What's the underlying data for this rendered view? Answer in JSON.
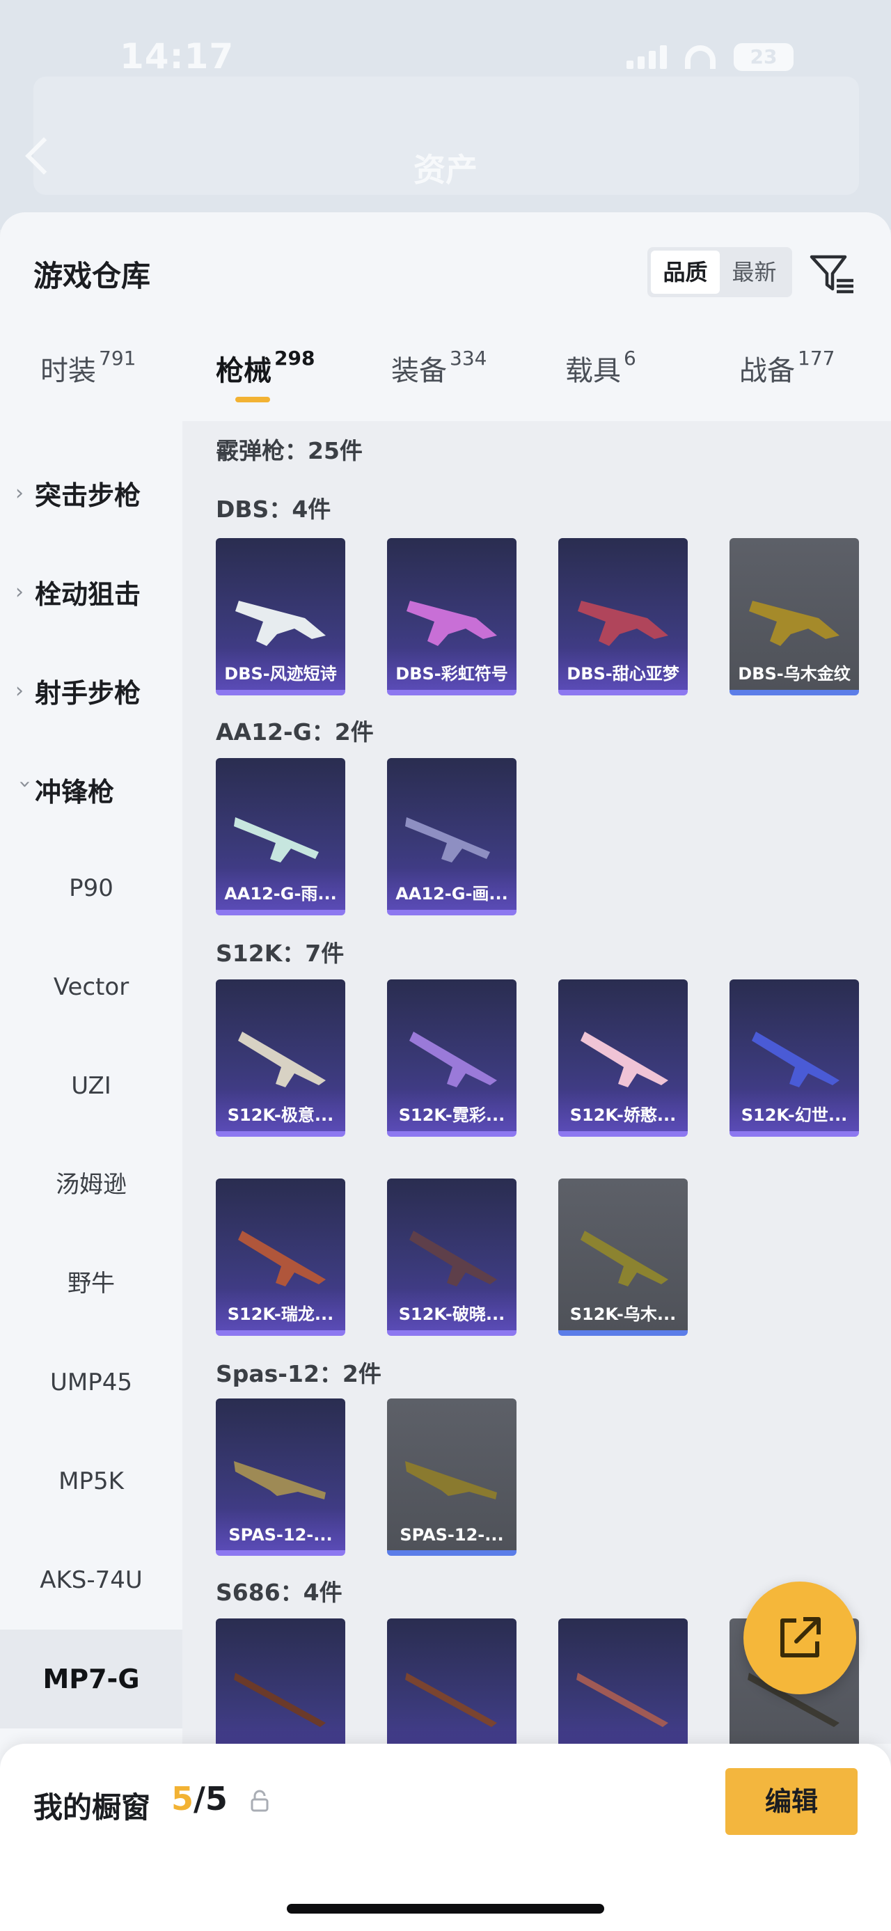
{
  "background": {
    "status_time": "14:17",
    "battery": "23",
    "nav_title": "资产"
  },
  "header": {
    "title": "游戏仓库",
    "sort_options": [
      "品质",
      "最新"
    ],
    "sort_selected": "品质"
  },
  "tabs": [
    {
      "label": "时装",
      "count": "791"
    },
    {
      "label": "枪械",
      "count": "298",
      "active": true
    },
    {
      "label": "装备",
      "count": "334"
    },
    {
      "label": "载具",
      "count": "6"
    },
    {
      "label": "战备",
      "count": "177"
    }
  ],
  "sidebar": {
    "categories": [
      {
        "label": "突击步枪",
        "expanded": false
      },
      {
        "label": "栓动狙击",
        "expanded": false
      },
      {
        "label": "射手步枪",
        "expanded": false
      },
      {
        "label": "冲锋枪",
        "expanded": true
      }
    ],
    "sub_items": [
      "P90",
      "Vector",
      "UZI",
      "汤姆逊",
      "野牛",
      "UMP45",
      "MP5K",
      "AKS-74U",
      "MP7-G"
    ],
    "active_sub": "MP7-G"
  },
  "content": {
    "header_partial": "霰弹枪：25件",
    "groups": [
      {
        "title": "DBS：4件",
        "items": [
          {
            "name": "DBS-风迹短诗",
            "quality": "purple"
          },
          {
            "name": "DBS-彩虹符号",
            "quality": "purple"
          },
          {
            "name": "DBS-甜心亚梦",
            "quality": "purple"
          },
          {
            "name": "DBS-乌木金纹",
            "quality": "blue"
          }
        ]
      },
      {
        "title": "AA12-G：2件",
        "items": [
          {
            "name": "AA12-G-雨...",
            "quality": "purple"
          },
          {
            "name": "AA12-G-画...",
            "quality": "purple"
          }
        ]
      },
      {
        "title": "S12K：7件",
        "items": [
          {
            "name": "S12K-极意...",
            "quality": "purple"
          },
          {
            "name": "S12K-霓彩...",
            "quality": "purple"
          },
          {
            "name": "S12K-娇憨...",
            "quality": "purple"
          },
          {
            "name": "S12K-幻世...",
            "quality": "purple"
          },
          {
            "name": "S12K-瑞龙...",
            "quality": "purple"
          },
          {
            "name": "S12K-破晓...",
            "quality": "purple"
          },
          {
            "name": "S12K-乌木...",
            "quality": "blue"
          }
        ]
      },
      {
        "title": "Spas-12：2件",
        "items": [
          {
            "name": "SPAS-12-...",
            "quality": "purple"
          },
          {
            "name": "SPAS-12-...",
            "quality": "blue"
          }
        ]
      },
      {
        "title": "S686：4件",
        "items": [
          {
            "name": "",
            "quality": "purple"
          },
          {
            "name": "",
            "quality": "purple"
          },
          {
            "name": "",
            "quality": "purple"
          },
          {
            "name": "",
            "quality": "blue"
          }
        ]
      }
    ]
  },
  "bottom_bar": {
    "title": "我的橱窗",
    "count_current": "5",
    "count_total": "/5",
    "edit_label": "编辑"
  },
  "colors": {
    "accent": "#f2b233",
    "purple_quality": "#8d78f0",
    "blue_quality": "#5b7de8"
  }
}
